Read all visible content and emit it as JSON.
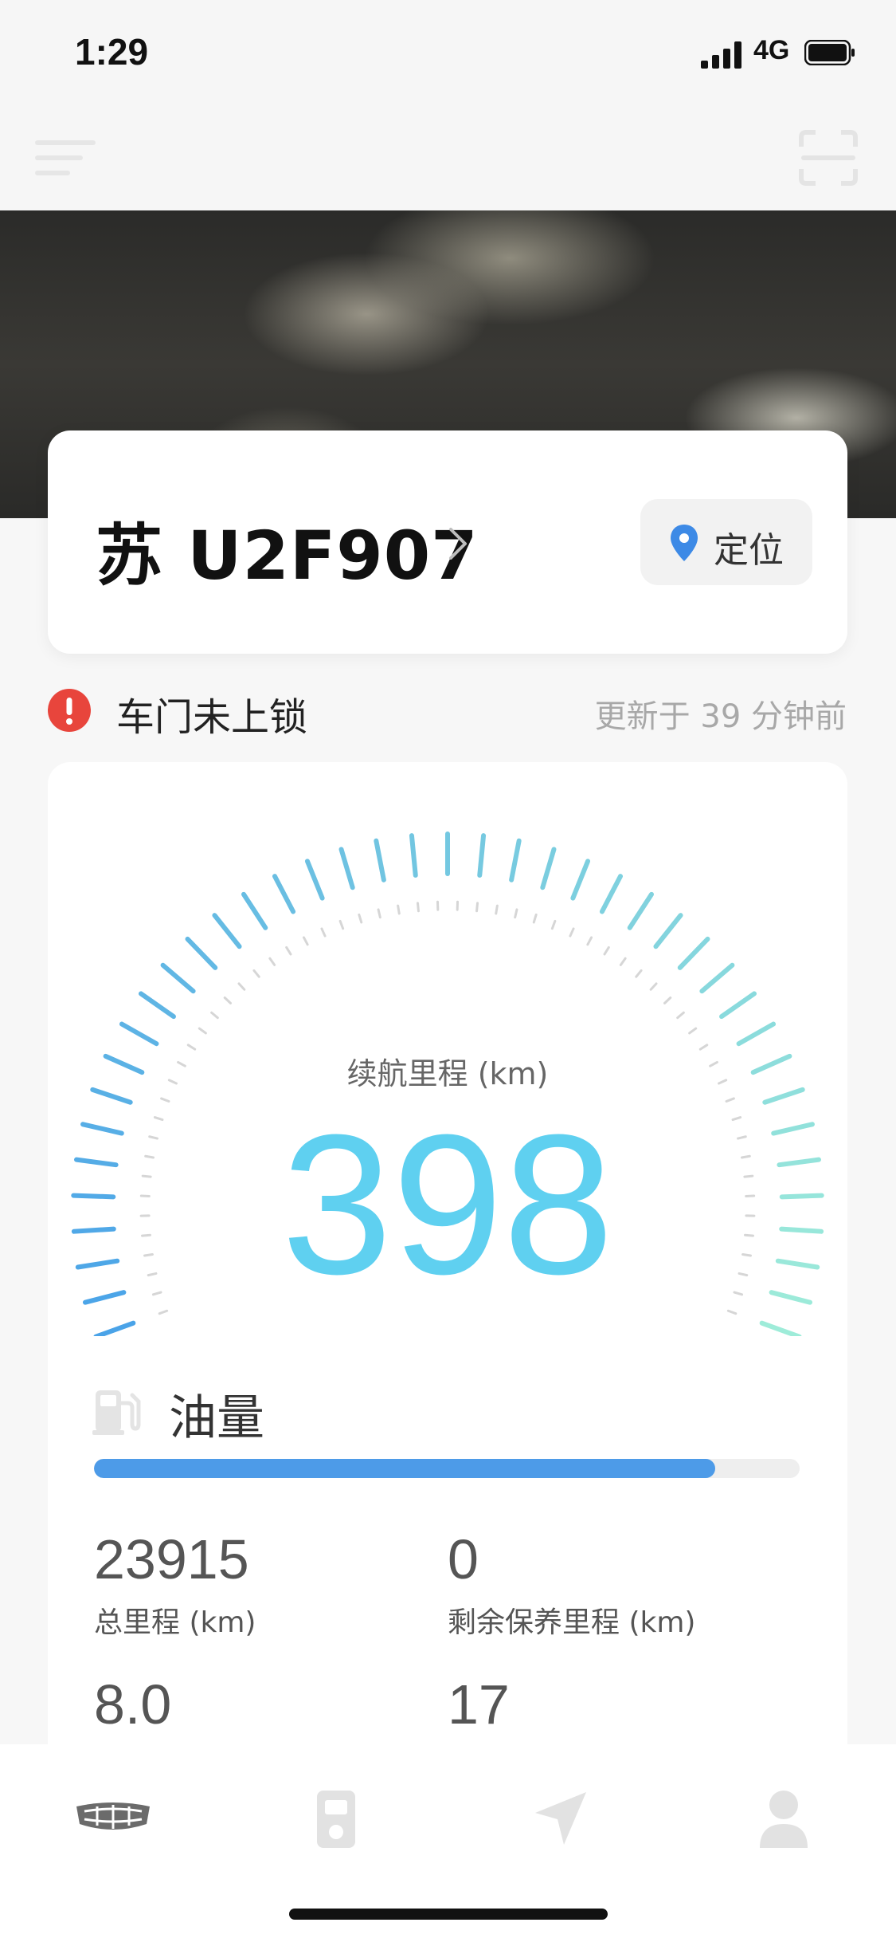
{
  "status_bar": {
    "time": "1:29",
    "network": "4G"
  },
  "vehicle": {
    "plate": "苏 U2F907",
    "locate_label": "定位"
  },
  "alert": {
    "text": "车门未上锁",
    "updated": "更新于 39 分钟前"
  },
  "range": {
    "label": "续航里程 (km)",
    "value": "398"
  },
  "fuel": {
    "label": "油量",
    "level_percent": 88
  },
  "stats": [
    {
      "value": "23915",
      "label": "总里程 (km)"
    },
    {
      "value": "0",
      "label": "剩余保养里程 (km)"
    },
    {
      "value": "8.0",
      "label": ""
    },
    {
      "value": "17",
      "label": ""
    }
  ],
  "colors": {
    "range_value": "#5fd0f0",
    "fuel_bar": "#4d9be8",
    "gauge_start": "#4aa3e8",
    "gauge_end": "#9eecd9",
    "alert": "#e8453c"
  },
  "tabs": [
    {
      "icon": "car-brand-icon",
      "active": true
    },
    {
      "icon": "remote-key-icon",
      "active": false
    },
    {
      "icon": "navigation-icon",
      "active": false
    },
    {
      "icon": "profile-icon",
      "active": false
    }
  ]
}
